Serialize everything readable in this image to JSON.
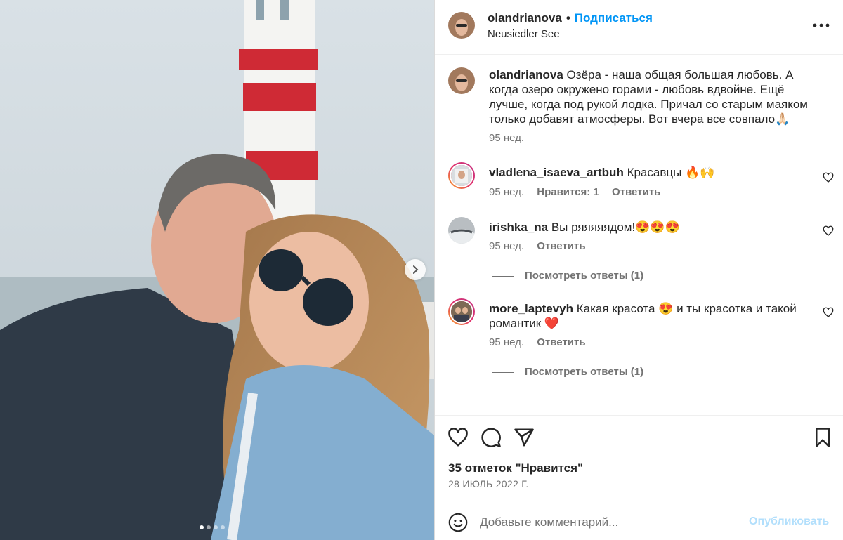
{
  "post": {
    "username": "olandrianova",
    "separator": "•",
    "follow_label": "Подписаться",
    "location": "Neusiedler See",
    "more_icon": "more-horizontal-icon"
  },
  "caption": {
    "username": "olandrianova",
    "text": "Озёра - наша общая большая любовь. А когда озеро окружено горами - любовь вдвойне. Ещё лучше, когда под рукой лодка. Причал со старым маяком только добавят атмосферы. Вот вчера все совпало🙏🏻",
    "time": "95 нед."
  },
  "comments": [
    {
      "username": "vladlena_isaeva_artbuh",
      "text": "Красавцы 🔥🙌",
      "time": "95 нед.",
      "likes": "Нравится: 1",
      "reply_label": "Ответить"
    },
    {
      "username": "irishka_na",
      "text": "Вы ряяяяядом!😍😍😍",
      "time": "95 нед.",
      "reply_label": "Ответить",
      "view_replies": "Посмотреть ответы (1)"
    },
    {
      "username": "more_laptevyh",
      "text": "Какая красота 😍 и ты красотка и такой романтик ❤️",
      "time": "95 нед.",
      "reply_label": "Ответить",
      "view_replies": "Посмотреть ответы (1)"
    }
  ],
  "actions": {
    "likes_text": "35 отметок \"Нравится\"",
    "date": "28 ИЮЛЬ 2022 Г."
  },
  "add_comment": {
    "placeholder": "Добавьте комментарий...",
    "publish_label": "Опубликовать"
  },
  "carousel": {
    "slide_count": 4,
    "active_slide": 1
  },
  "colors": {
    "accent": "#0095f6",
    "publish_disabled": "#b2dffc",
    "secondary_text": "#737373"
  }
}
